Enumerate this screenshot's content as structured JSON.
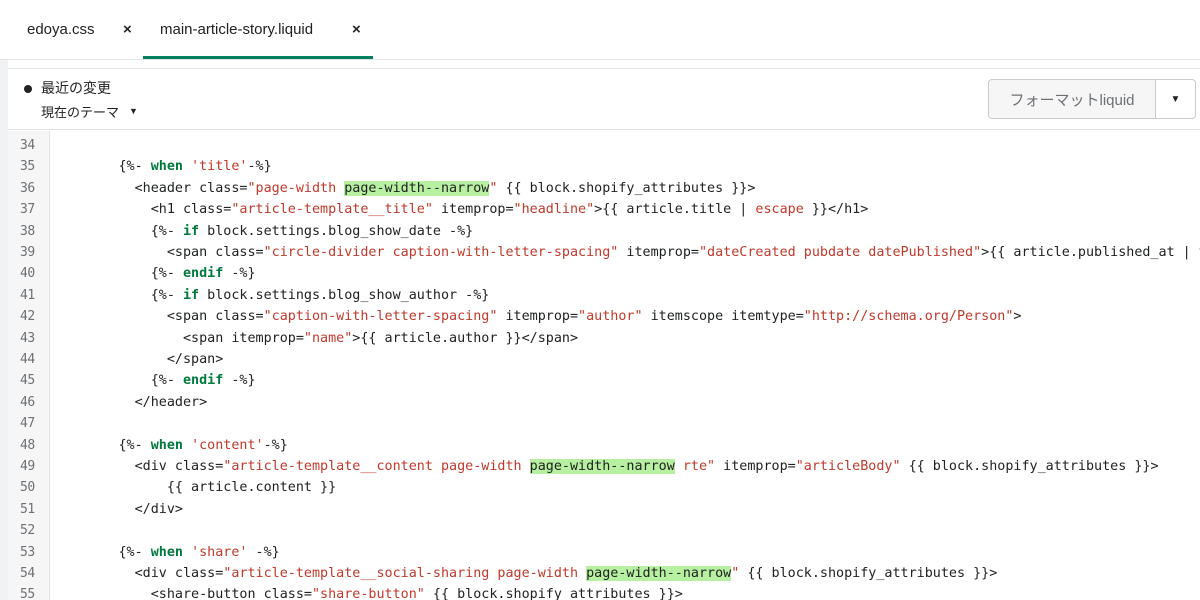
{
  "tabs": [
    {
      "label": "edoya.css",
      "close": "×"
    },
    {
      "label": "main-article-story.liquid",
      "close": "×"
    }
  ],
  "subheader": {
    "recent_label": "最近の変更",
    "theme_label": "現在のテーマ",
    "theme_caret": "▼",
    "format_button": "フォーマットliquid",
    "format_dropdown": "▼"
  },
  "colors": {
    "accent": "#007f5f",
    "keyword": "#007a3d",
    "string": "#c0392b",
    "highlight": "#b7f0a1"
  },
  "code_lines": [
    {
      "n": "34",
      "segs": []
    },
    {
      "n": "35",
      "segs": [
        [
          "t",
          "        {%- "
        ],
        [
          "kw",
          "when"
        ],
        [
          "t",
          " "
        ],
        [
          "str",
          "'title'"
        ],
        [
          "t",
          "-%}"
        ]
      ]
    },
    {
      "n": "36",
      "segs": [
        [
          "t",
          "          <header class="
        ],
        [
          "q",
          "\""
        ],
        [
          "str",
          "page-width "
        ],
        [
          "hl",
          "page-width--narrow"
        ],
        [
          "q",
          "\""
        ],
        [
          "t",
          " {{ block.shopify_attributes }}>"
        ]
      ]
    },
    {
      "n": "37",
      "segs": [
        [
          "t",
          "            <h1 class="
        ],
        [
          "str",
          "\"article-template__title\""
        ],
        [
          "t",
          " itemprop="
        ],
        [
          "str",
          "\"headline\""
        ],
        [
          "t",
          ">{{ article.title | "
        ],
        [
          "str",
          "escape"
        ],
        [
          "t",
          " }}</h1>"
        ]
      ]
    },
    {
      "n": "38",
      "segs": [
        [
          "t",
          "            {%- "
        ],
        [
          "kw",
          "if"
        ],
        [
          "t",
          " block.settings.blog_show_date -%}"
        ]
      ]
    },
    {
      "n": "39",
      "segs": [
        [
          "t",
          "              <span class="
        ],
        [
          "str",
          "\"circle-divider caption-with-letter-spacing\""
        ],
        [
          "t",
          " itemprop="
        ],
        [
          "str",
          "\"dateCreated pubdate datePublished\""
        ],
        [
          "t",
          ">{{ article.published_at | time"
        ]
      ]
    },
    {
      "n": "40",
      "segs": [
        [
          "t",
          "            {%- "
        ],
        [
          "kw",
          "endif"
        ],
        [
          "t",
          " -%}"
        ]
      ]
    },
    {
      "n": "41",
      "segs": [
        [
          "t",
          "            {%- "
        ],
        [
          "kw",
          "if"
        ],
        [
          "t",
          " block.settings.blog_show_author -%}"
        ]
      ]
    },
    {
      "n": "42",
      "segs": [
        [
          "t",
          "              <span class="
        ],
        [
          "str",
          "\"caption-with-letter-spacing\""
        ],
        [
          "t",
          " itemprop="
        ],
        [
          "str",
          "\"author\""
        ],
        [
          "t",
          " itemscope itemtype="
        ],
        [
          "str",
          "\"http://schema.org/Person\""
        ],
        [
          "t",
          ">"
        ]
      ]
    },
    {
      "n": "43",
      "segs": [
        [
          "t",
          "                <span itemprop="
        ],
        [
          "str",
          "\"name\""
        ],
        [
          "t",
          ">{{ article.author }}</span>"
        ]
      ]
    },
    {
      "n": "44",
      "segs": [
        [
          "t",
          "              </span>"
        ]
      ]
    },
    {
      "n": "45",
      "segs": [
        [
          "t",
          "            {%- "
        ],
        [
          "kw",
          "endif"
        ],
        [
          "t",
          " -%}"
        ]
      ]
    },
    {
      "n": "46",
      "segs": [
        [
          "t",
          "          </header>"
        ]
      ]
    },
    {
      "n": "47",
      "segs": []
    },
    {
      "n": "48",
      "segs": [
        [
          "t",
          "        {%- "
        ],
        [
          "kw",
          "when"
        ],
        [
          "t",
          " "
        ],
        [
          "str",
          "'content'"
        ],
        [
          "t",
          "-%}"
        ]
      ]
    },
    {
      "n": "49",
      "segs": [
        [
          "t",
          "          <div class="
        ],
        [
          "q",
          "\""
        ],
        [
          "str",
          "article-template__content page-width "
        ],
        [
          "hl",
          "page-width--narrow"
        ],
        [
          "str",
          " rte"
        ],
        [
          "q",
          "\""
        ],
        [
          "t",
          " itemprop="
        ],
        [
          "str",
          "\"articleBody\""
        ],
        [
          "t",
          " {{ block.shopify_attributes }}>"
        ]
      ]
    },
    {
      "n": "50",
      "segs": [
        [
          "t",
          "              {{ article.content }}"
        ]
      ]
    },
    {
      "n": "51",
      "segs": [
        [
          "t",
          "          </div>"
        ]
      ]
    },
    {
      "n": "52",
      "segs": []
    },
    {
      "n": "53",
      "segs": [
        [
          "t",
          "        {%- "
        ],
        [
          "kw",
          "when"
        ],
        [
          "t",
          " "
        ],
        [
          "str",
          "'share'"
        ],
        [
          "t",
          " -%}"
        ]
      ]
    },
    {
      "n": "54",
      "segs": [
        [
          "t",
          "          <div class="
        ],
        [
          "q",
          "\""
        ],
        [
          "str",
          "article-template__social-sharing page-width "
        ],
        [
          "hl",
          "page-width--narrow"
        ],
        [
          "q",
          "\""
        ],
        [
          "t",
          " {{ block.shopify_attributes }}>"
        ]
      ]
    },
    {
      "n": "55",
      "segs": [
        [
          "t",
          "            <share-button class="
        ],
        [
          "str",
          "\"share-button\""
        ],
        [
          "t",
          " {{ block.shopify_attributes }}>"
        ]
      ]
    }
  ]
}
